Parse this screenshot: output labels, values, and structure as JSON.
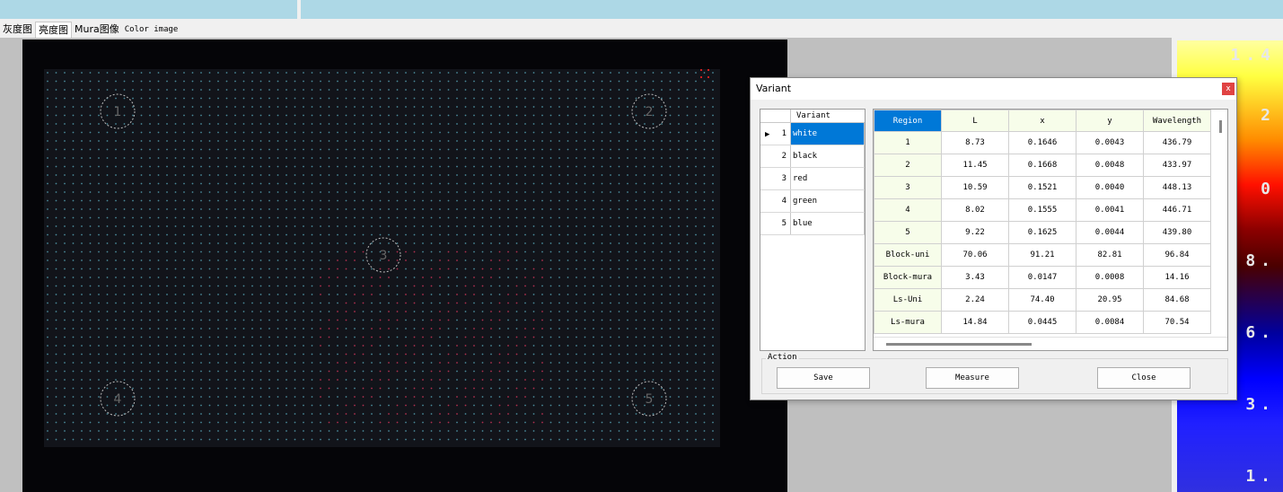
{
  "tabs": [
    "灰度图",
    "亮度图",
    "Mura图像",
    "Color image"
  ],
  "colorbar": {
    "ticks": [
      "1.4",
      "2",
      "0",
      "8.",
      "6.",
      "3.",
      "1."
    ]
  },
  "image": {
    "region_labels": [
      "1",
      "2",
      "3",
      "4",
      "5"
    ]
  },
  "dialog": {
    "title": "Variant",
    "close_label": "x",
    "variant_list": {
      "header": "Variant",
      "rows": [
        {
          "index": "1",
          "name": "white"
        },
        {
          "index": "2",
          "name": "black"
        },
        {
          "index": "3",
          "name": "red"
        },
        {
          "index": "4",
          "name": "green"
        },
        {
          "index": "5",
          "name": "blue"
        }
      ],
      "selected_index": 1
    },
    "grid": {
      "columns": [
        "Region",
        "L",
        "x",
        "y",
        "Wavelength"
      ],
      "rows": [
        [
          "1",
          "8.73",
          "0.1646",
          "0.0043",
          "436.79"
        ],
        [
          "2",
          "11.45",
          "0.1668",
          "0.0048",
          "433.97"
        ],
        [
          "3",
          "10.59",
          "0.1521",
          "0.0040",
          "448.13"
        ],
        [
          "4",
          "8.02",
          "0.1555",
          "0.0041",
          "446.71"
        ],
        [
          "5",
          "9.22",
          "0.1625",
          "0.0044",
          "439.80"
        ],
        [
          "Block-uni",
          "70.06",
          "91.21",
          "82.81",
          "96.84"
        ],
        [
          "Block-mura",
          "3.43",
          "0.0147",
          "0.0008",
          "14.16"
        ],
        [
          "Ls-Uni",
          "2.24",
          "74.40",
          "20.95",
          "84.68"
        ],
        [
          "Ls-mura",
          "14.84",
          "0.0445",
          "0.0084",
          "70.54"
        ]
      ]
    },
    "action": {
      "legend": "Action",
      "save_label": "Save",
      "measure_label": "Measure",
      "close_label": "Close"
    }
  }
}
